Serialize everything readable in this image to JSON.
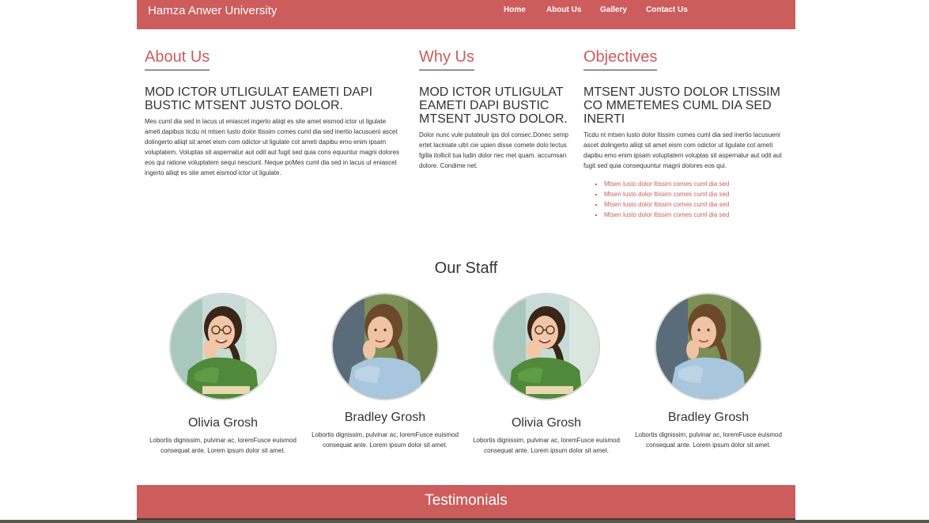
{
  "navbar": {
    "brand": "Hamza Anwer University",
    "links": [
      "Home",
      "About Us",
      "Gallery",
      "Contact Us"
    ],
    "bg_color": "#cd5c5c"
  },
  "about": {
    "heading": "About Us",
    "subheading": "MOD ICTOR UTLIGULAT EAMETI DAPI BUSTIC MTSENT JUSTO DOLOR.",
    "text": "Mes cuml dia sed in lacus ut eniascet ingerto aliiqt es site amet eismod ictor ut ligulate ameti dapibus ticdu nt mtsen lusto dolor ltissim comes cuml dia sed inertio lacusueni ascet dolingerto aliiqt sit amet eism com odictor ut ligulate cot ameti dapibu emo enim ipsam voluptatem. Voluptas sit aspernatur aut odit aut fugit sed quia cons equuntur magni dolores eos qui ratione voluptatem sequi nesciunt. Neque poMes cuml dia sed in lacus ut eniascet ingerto aliiqt es site amet eismod ictor ut ligulate."
  },
  "why": {
    "heading": "Why Us",
    "subheading": "MOD ICTOR UTLIGULAT EAMETI DAPI BUSTIC MTSENT JUSTO DOLOR.",
    "text": "Dolor nunc vule putateulr ips dol consec.Donec semp ertet laciniate ultri cie upien disse comete dolo lectus fgilla itollicil tua ludin dolor nec met quam. accumsan dolore. Condime net."
  },
  "objectives": {
    "heading": "Objectives",
    "subheading": "MTSENT JUSTO DOLOR LTISSIM CO MMETEMES CUML DIA SED INERTI",
    "text": "Ticdu nt mtsen lusto dolor ltissim comes cuml dia sed inertio lacusueni ascet dolingerto aliiqt sit amet eism com odictor ut ligulate cot ameti dapibu emo enim ipsam voluptatem voluptas sit aspernatur aut odit aut fugit sed quia consequuntur magni dolores eos qui.",
    "items": [
      "Mtsen lusto dolor ltissim comes cuml dia sed",
      "Mtsen lusto dolor ltissim comes cuml dia sed",
      "Mtsen lusto dolor ltissim comes cuml dia sed",
      "Mtsen lusto dolor ltissim comes cuml dia sed"
    ]
  },
  "staff": {
    "title": "Our Staff",
    "members": [
      {
        "name": "Olivia Grosh",
        "desc": "Lobortis dignissim, pulvinar ac, loremFusce euismod consequat ante. Lorem ipsum dolor sit amet.",
        "photo": "woman-glasses-green-shirt"
      },
      {
        "name": "Bradley Grosh",
        "desc": "Lobortis dignissim, pulvinar ac, loremFusce euismod consequat ante. Lorem ipsum dolor sit amet.",
        "photo": "woman-blue-shirt"
      },
      {
        "name": "Olivia Grosh",
        "desc": "Lobortis dignissim, pulvinar ac, loremFusce euismod consequat ante. Lorem ipsum dolor sit amet.",
        "photo": "woman-glasses-green-shirt"
      },
      {
        "name": "Bradley Grosh",
        "desc": "Lobortis dignissim, pulvinar ac, loremFusce euismod consequat ante. Lorem ipsum dolor sit amet.",
        "photo": "woman-blue-shirt"
      }
    ]
  },
  "testimonials": {
    "title": "Testimonials"
  },
  "colors": {
    "accent": "#cd5c5c",
    "text": "#333333"
  }
}
